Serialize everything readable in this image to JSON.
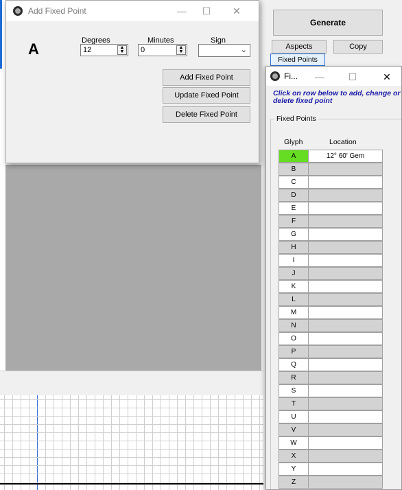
{
  "add_dialog": {
    "title": "Add Fixed Point",
    "glyph": "A",
    "degrees_label": "Degrees",
    "minutes_label": "Minutes",
    "sign_label": "Sign",
    "degrees_value": "12",
    "minutes_value": "0",
    "sign_value": "",
    "add_button": "Add Fixed Point",
    "update_button": "Update Fixed Point",
    "delete_button": "Delete Fixed Point",
    "minimize": "—",
    "maximize": "☐",
    "close": "✕"
  },
  "main_panel": {
    "generate_button": "Generate",
    "aspects_button": "Aspects",
    "copy_button": "Copy",
    "fixed_points_button": "Fixed Points"
  },
  "list_dialog": {
    "title": "Fi...",
    "minimize": "—",
    "maximize": "☐",
    "close": "✕",
    "instruction": "Click on row below to add, change or delete fixed point",
    "group_label": "Fixed Points",
    "col_glyph": "Glyph",
    "col_location": "Location",
    "selected_color": "#66dd22",
    "rows": [
      {
        "glyph": "A",
        "location": "12° 60' Gem"
      },
      {
        "glyph": "B",
        "location": ""
      },
      {
        "glyph": "C",
        "location": ""
      },
      {
        "glyph": "D",
        "location": ""
      },
      {
        "glyph": "E",
        "location": ""
      },
      {
        "glyph": "F",
        "location": ""
      },
      {
        "glyph": "G",
        "location": ""
      },
      {
        "glyph": "H",
        "location": ""
      },
      {
        "glyph": "I",
        "location": ""
      },
      {
        "glyph": "J",
        "location": ""
      },
      {
        "glyph": "K",
        "location": ""
      },
      {
        "glyph": "L",
        "location": ""
      },
      {
        "glyph": "M",
        "location": ""
      },
      {
        "glyph": "N",
        "location": ""
      },
      {
        "glyph": "O",
        "location": ""
      },
      {
        "glyph": "P",
        "location": ""
      },
      {
        "glyph": "Q",
        "location": ""
      },
      {
        "glyph": "R",
        "location": ""
      },
      {
        "glyph": "S",
        "location": ""
      },
      {
        "glyph": "T",
        "location": ""
      },
      {
        "glyph": "U",
        "location": ""
      },
      {
        "glyph": "V",
        "location": ""
      },
      {
        "glyph": "W",
        "location": ""
      },
      {
        "glyph": "X",
        "location": ""
      },
      {
        "glyph": "Y",
        "location": ""
      },
      {
        "glyph": "Z",
        "location": ""
      }
    ]
  }
}
